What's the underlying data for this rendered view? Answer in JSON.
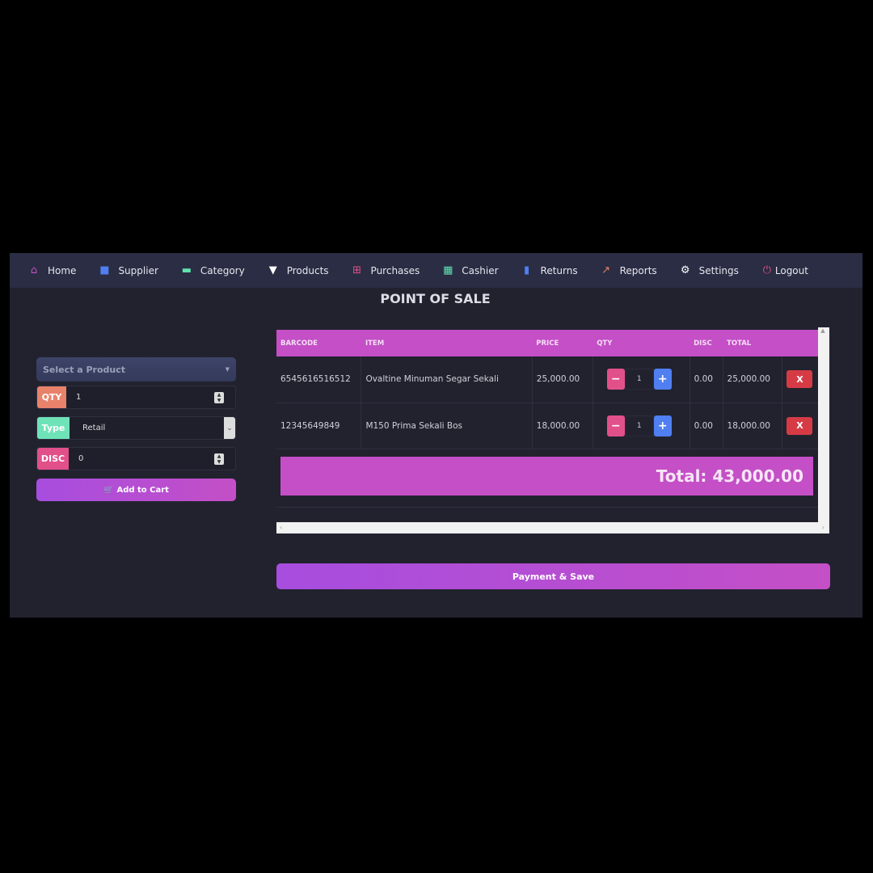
{
  "nav": [
    {
      "label": "Home",
      "icon": "home-icon",
      "color": "#c94fc9",
      "glyph": "⌂"
    },
    {
      "label": "Supplier",
      "icon": "truck-icon",
      "color": "#4f7ff0",
      "glyph": "■"
    },
    {
      "label": "Category",
      "icon": "box-open-icon",
      "color": "#5fe3b0",
      "glyph": "▬"
    },
    {
      "label": "Products",
      "icon": "tshirt-icon",
      "color": "#ffffff",
      "glyph": "▼"
    },
    {
      "label": "Purchases",
      "icon": "cart-plus-icon",
      "color": "#e2508a",
      "glyph": "⊞"
    },
    {
      "label": "Cashier",
      "icon": "cash-register-icon",
      "color": "#5fe3b0",
      "glyph": "▦"
    },
    {
      "label": "Returns",
      "icon": "receipt-icon",
      "color": "#4f7ff0",
      "glyph": "▮"
    },
    {
      "label": "Reports",
      "icon": "chart-line-icon",
      "color": "#e8826a",
      "glyph": "↗"
    },
    {
      "label": "Settings",
      "icon": "gear-icon",
      "color": "#ffffff",
      "glyph": "⚙"
    },
    {
      "label": "Logout",
      "icon": "power-icon",
      "color": "#e2508a",
      "glyph": "⏻"
    }
  ],
  "title": "POINT OF SALE",
  "form": {
    "product_placeholder": "Select a Product",
    "qty_label": "QTY",
    "qty_value": "1",
    "qty_color": "#e8826a",
    "type_label": "Type",
    "type_value": "Retail",
    "type_color": "#6fe3b8",
    "disc_label": "DISC",
    "disc_value": "0",
    "disc_color": "#e2508a",
    "add_label": "Add to Cart"
  },
  "table": {
    "headers": [
      "BARCODE",
      "ITEM",
      "PRICE",
      "QTY",
      "DISC",
      "TOTAL",
      ""
    ],
    "rows": [
      {
        "barcode": "6545616516512",
        "item": "Ovaltine Minuman Segar Sekali",
        "price": "25,000.00",
        "qty": "1",
        "disc": "0.00",
        "total": "25,000.00"
      },
      {
        "barcode": "12345649849",
        "item": "M150 Prima Sekali Bos",
        "price": "18,000.00",
        "qty": "1",
        "disc": "0.00",
        "total": "18,000.00"
      }
    ],
    "remove_label": "X",
    "total": "Total: 43,000.00"
  },
  "pay_label": "Payment & Save",
  "colors": {
    "accent": "#c44fc6",
    "minus": "#e2508a",
    "plus": "#4f7ff0",
    "remove": "#d63b45"
  }
}
